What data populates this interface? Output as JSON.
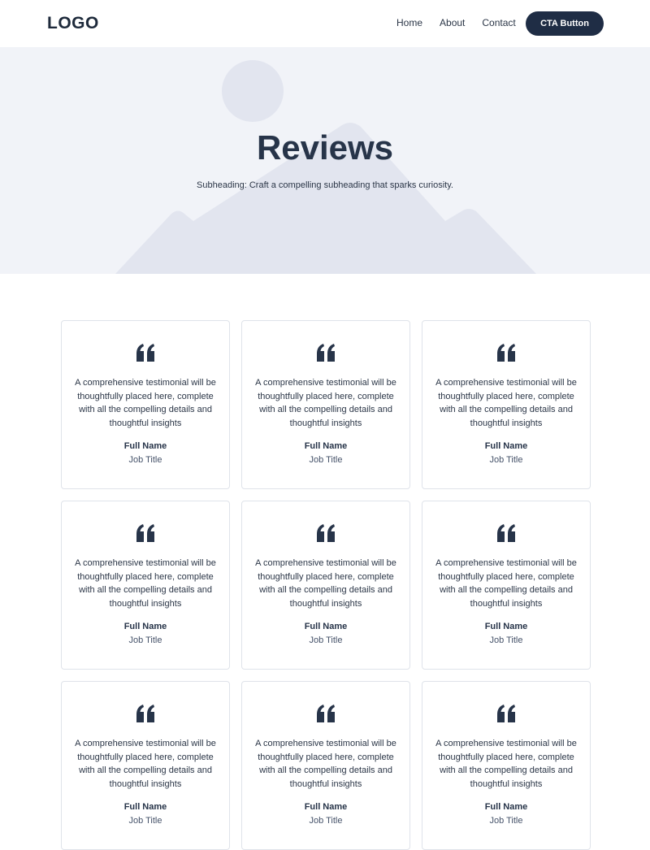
{
  "header": {
    "logo": "LOGO",
    "nav": [
      "Home",
      "About",
      "Contact"
    ],
    "cta_label": "CTA Button"
  },
  "hero": {
    "title": "Reviews",
    "subheading": "Subheading: Craft a compelling subheading that sparks curiosity."
  },
  "testimonials": [
    {
      "text": "A comprehensive testimonial will be thoughtfully placed here, complete with all the compelling details and thoughtful insights",
      "name": "Full Name",
      "job": "Job Title"
    },
    {
      "text": "A comprehensive testimonial will be thoughtfully placed here, complete with all the compelling details and thoughtful insights",
      "name": "Full Name",
      "job": "Job Title"
    },
    {
      "text": "A comprehensive testimonial will be thoughtfully placed here, complete with all the compelling details and thoughtful insights",
      "name": "Full Name",
      "job": "Job Title"
    },
    {
      "text": "A comprehensive testimonial will be thoughtfully placed here, complete with all the compelling details and thoughtful insights",
      "name": "Full Name",
      "job": "Job Title"
    },
    {
      "text": "A comprehensive testimonial will be thoughtfully placed here, complete with all the compelling details and thoughtful insights",
      "name": "Full Name",
      "job": "Job Title"
    },
    {
      "text": "A comprehensive testimonial will be thoughtfully placed here, complete with all the compelling details and thoughtful insights",
      "name": "Full Name",
      "job": "Job Title"
    },
    {
      "text": "A comprehensive testimonial will be thoughtfully placed here, complete with all the compelling details and thoughtful insights",
      "name": "Full Name",
      "job": "Job Title"
    },
    {
      "text": "A comprehensive testimonial will be thoughtfully placed here, complete with all the compelling details and thoughtful insights",
      "name": "Full Name",
      "job": "Job Title"
    },
    {
      "text": "A comprehensive testimonial will be thoughtfully placed here, complete with all the compelling details and thoughtful insights",
      "name": "Full Name",
      "job": "Job Title"
    }
  ],
  "icons": {
    "quote": "quote-icon",
    "hero_image": "image-placeholder-icon"
  },
  "colors": {
    "primary": "#1f2d45",
    "hero_bg": "#f1f3f8",
    "illustration": "#e2e5ef",
    "card_border": "#dfe3ea",
    "text": "#2b3647"
  }
}
